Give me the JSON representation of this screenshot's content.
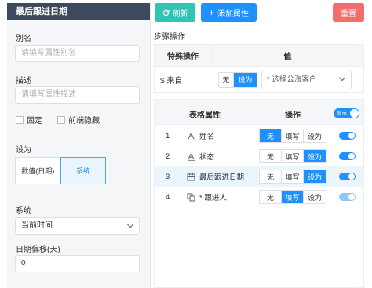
{
  "left_panel": {
    "title": "最后跟进日期",
    "alias_label": "别名",
    "alias_placeholder": "请填写属性别名",
    "desc_label": "描述",
    "desc_placeholder": "请填写属性描述",
    "fixed_label": "固定",
    "hide_label": "前端隐藏",
    "set_label": "设为",
    "set_options": [
      "数值(日期)",
      "系统"
    ],
    "set_selected": "系统",
    "system_label": "系统",
    "system_value": "当前时间",
    "offset_label": "日期偏移(天)",
    "offset_value": "0"
  },
  "toolbar": {
    "refresh_label": "刷新",
    "add_label": "添加属性",
    "reset_label": "重置"
  },
  "steps": {
    "title": "步骤操作",
    "head_special": "特殊操作",
    "head_value": "值",
    "row_label": "$ 来自",
    "toggle_off": "无",
    "toggle_on": "设为",
    "select_value": "* 选择公海客户"
  },
  "props": {
    "head_attr": "表格属性",
    "head_op": "操作",
    "show_label": "显示",
    "op_labels": [
      "无",
      "填写",
      "设为"
    ],
    "rows": [
      {
        "num": "1",
        "icon": "text-icon",
        "name": "姓名",
        "active": 0,
        "toggle_on": true
      },
      {
        "num": "2",
        "icon": "text-icon",
        "name": "状态",
        "active": 2,
        "toggle_on": true
      },
      {
        "num": "3",
        "icon": "calendar-icon",
        "name": "最后跟进日期",
        "active": 2,
        "toggle_on": true
      },
      {
        "num": "4",
        "icon": "copy-icon",
        "name": "* 跟进人",
        "active": 1,
        "toggle_on": false
      }
    ]
  },
  "colors": {
    "header_dark": "#3d4a5c",
    "refresh": "#2ec4b6",
    "primary": "#1e90ff",
    "danger": "#f56c6c"
  }
}
